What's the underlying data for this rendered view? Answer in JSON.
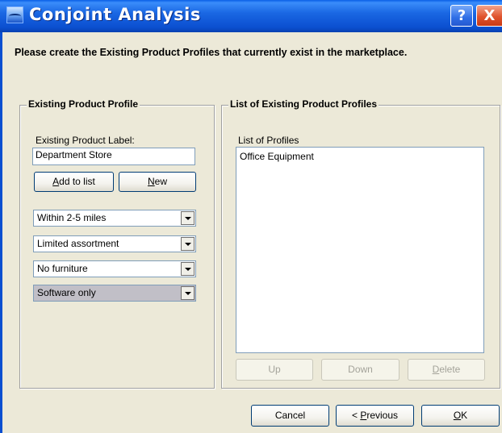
{
  "window": {
    "title": "Conjoint Analysis",
    "help_label": "?",
    "close_label": "X"
  },
  "instructions": "Please create the Existing Product Profiles that currently exist in the marketplace.",
  "existing_profile": {
    "group_title": "Existing Product Profile",
    "label_caption": "Existing Product Label:",
    "label_value": "Department Store",
    "add_button": {
      "mnemonic": "A",
      "rest": "dd to list"
    },
    "new_button": {
      "mnemonic": "N",
      "rest": "ew"
    },
    "attributes": [
      {
        "value": "Within 2-5 miles",
        "selected": false
      },
      {
        "value": "Limited assortment",
        "selected": false
      },
      {
        "value": "No furniture",
        "selected": false
      },
      {
        "value": "Software only",
        "selected": true
      }
    ]
  },
  "profiles_list": {
    "group_title": "List of Existing Product Profiles",
    "caption": "List of Profiles",
    "items": [
      "Office Equipment"
    ],
    "up_label": "Up",
    "down_label": "Down",
    "delete_button": {
      "mnemonic": "D",
      "rest": "elete"
    }
  },
  "footer": {
    "cancel_label": "Cancel",
    "previous_button": {
      "prefix": "< ",
      "mnemonic": "P",
      "rest": "revious"
    },
    "ok_button": {
      "mnemonic": "O",
      "rest": "K"
    }
  }
}
